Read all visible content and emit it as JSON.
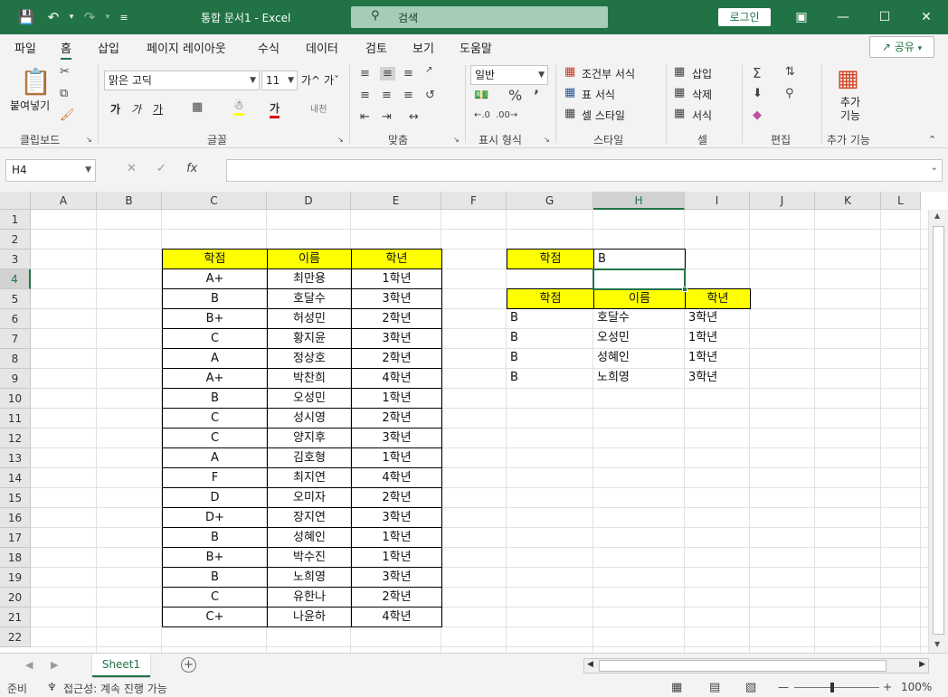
{
  "window": {
    "title": "통합 문서1  -  Excel",
    "search_placeholder": "검색",
    "login": "로그인"
  },
  "menu": {
    "tabs": [
      "파일",
      "홈",
      "삽입",
      "페이지 레이아웃",
      "수식",
      "데이터",
      "검토",
      "보기",
      "도움말"
    ],
    "active": "홈",
    "share": "공유"
  },
  "ribbon": {
    "clipboard": {
      "label": "클립보드",
      "paste": "붙여넣기"
    },
    "font": {
      "label": "글꼴",
      "name": "맑은 고딕",
      "size": "11",
      "bold": "가",
      "italic": "가",
      "underline": "가",
      "grow": "가^",
      "shrink": "가ˇ",
      "color_a": "가",
      "phonetic": "내천"
    },
    "alignment": {
      "label": "맞춤"
    },
    "number": {
      "label": "표시 형식",
      "format": "일반"
    },
    "styles": {
      "label": "스타일",
      "conditional": "조건부 서식",
      "table": "표 서식",
      "cell": "셀 스타일"
    },
    "cells": {
      "label": "셀",
      "insert": "삽입",
      "delete": "삭제",
      "format": "서식"
    },
    "editing": {
      "label": "편집"
    },
    "addins": {
      "label": "추가 기능",
      "button": "추가 기능"
    }
  },
  "formula_bar": {
    "name_box": "H4",
    "formula": ""
  },
  "columns": [
    "A",
    "B",
    "C",
    "D",
    "E",
    "F",
    "G",
    "H",
    "I",
    "J",
    "K",
    "L"
  ],
  "selected_cell": "H4",
  "rows": [
    1,
    2,
    3,
    4,
    5,
    6,
    7,
    8,
    9,
    10,
    11,
    12,
    13,
    14,
    15,
    16,
    17,
    18,
    19,
    20,
    21,
    22
  ],
  "source_table": {
    "headers": [
      "학점",
      "이름",
      "학년"
    ],
    "rows": [
      [
        "A+",
        "최만용",
        "1학년"
      ],
      [
        "B",
        "호달수",
        "3학년"
      ],
      [
        "B+",
        "허성민",
        "2학년"
      ],
      [
        "C",
        "황지윤",
        "3학년"
      ],
      [
        "A",
        "정상호",
        "2학년"
      ],
      [
        "A+",
        "박찬희",
        "4학년"
      ],
      [
        "B",
        "오성민",
        "1학년"
      ],
      [
        "C",
        "성시영",
        "2학년"
      ],
      [
        "C",
        "양지후",
        "3학년"
      ],
      [
        "A",
        "김호형",
        "1학년"
      ],
      [
        "F",
        "최지연",
        "4학년"
      ],
      [
        "D",
        "오미자",
        "2학년"
      ],
      [
        "D+",
        "장지연",
        "3학년"
      ],
      [
        "B",
        "성혜인",
        "1학년"
      ],
      [
        "B+",
        "박수진",
        "1학년"
      ],
      [
        "B",
        "노희영",
        "3학년"
      ],
      [
        "C",
        "유한나",
        "2학년"
      ],
      [
        "C+",
        "나윤하",
        "4학년"
      ]
    ]
  },
  "criteria": {
    "label": "학점",
    "value": "B"
  },
  "result_table": {
    "headers": [
      "학점",
      "이름",
      "학년"
    ],
    "rows": [
      [
        "B",
        "호달수",
        "3학년"
      ],
      [
        "B",
        "오성민",
        "1학년"
      ],
      [
        "B",
        "성혜인",
        "1학년"
      ],
      [
        "B",
        "노희영",
        "3학년"
      ]
    ]
  },
  "sheets": [
    "Sheet1"
  ],
  "status": {
    "ready": "준비",
    "accessibility": "접근성: 계속 진행 가능",
    "zoom": "100%"
  }
}
